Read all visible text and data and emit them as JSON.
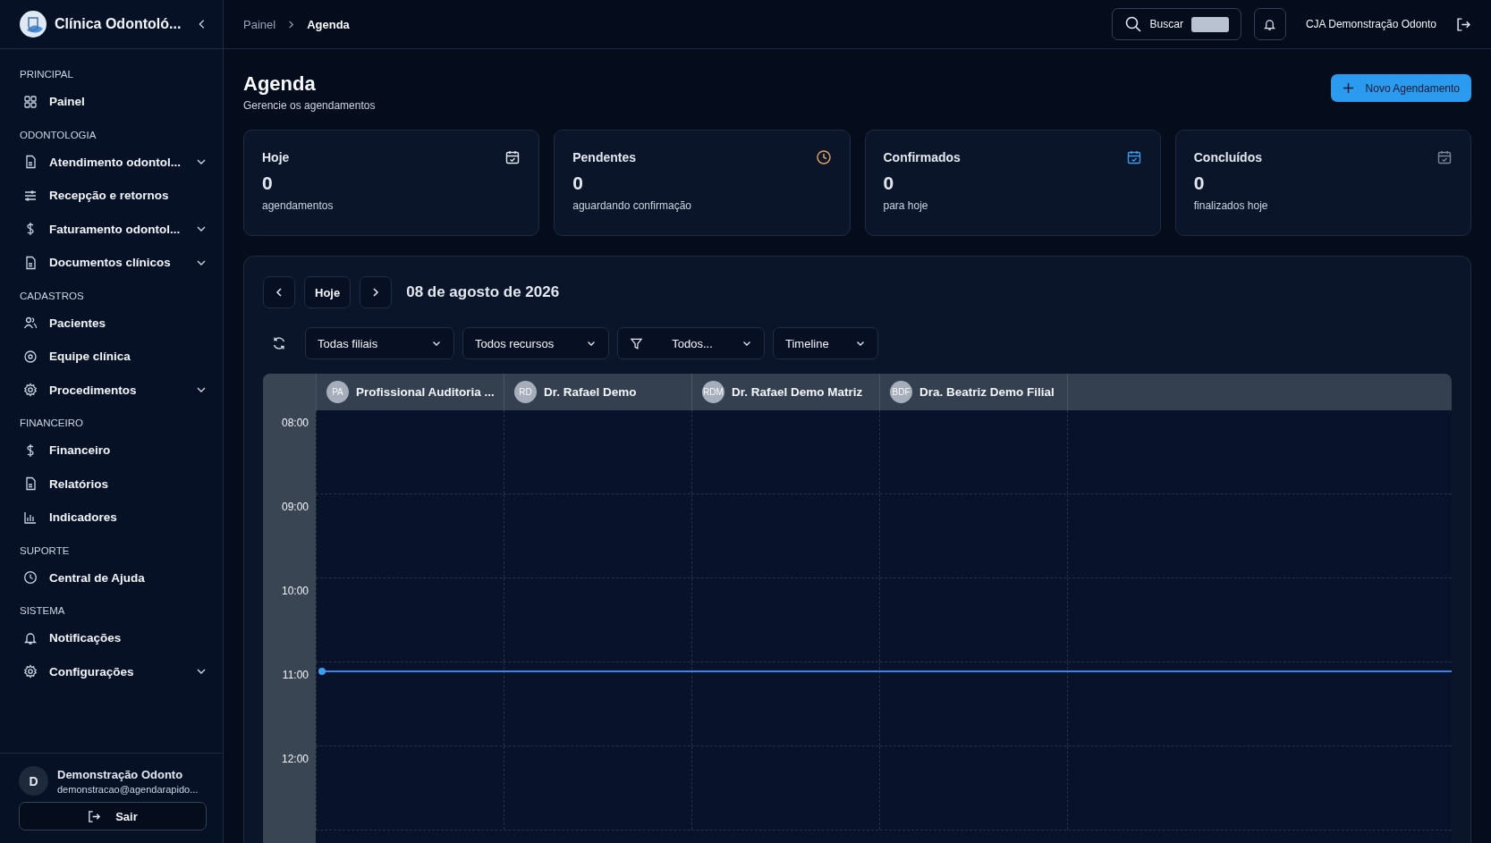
{
  "sidebar": {
    "brand": "Clínica Odontoló...",
    "sections": [
      {
        "title": "PRINCIPAL",
        "items": [
          {
            "label": "Painel",
            "expandable": false
          }
        ]
      },
      {
        "title": "ODONTOLOGIA",
        "items": [
          {
            "label": "Atendimento odontol...",
            "expandable": true
          },
          {
            "label": "Recepção e retornos",
            "expandable": false
          },
          {
            "label": "Faturamento odontol...",
            "expandable": true
          },
          {
            "label": "Documentos clínicos",
            "expandable": true
          }
        ]
      },
      {
        "title": "CADASTROS",
        "items": [
          {
            "label": "Pacientes",
            "expandable": false
          },
          {
            "label": "Equipe clínica",
            "expandable": false
          },
          {
            "label": "Procedimentos",
            "expandable": true
          }
        ]
      },
      {
        "title": "FINANCEIRO",
        "items": [
          {
            "label": "Financeiro",
            "expandable": false
          },
          {
            "label": "Relatórios",
            "expandable": false
          },
          {
            "label": "Indicadores",
            "expandable": false
          }
        ]
      },
      {
        "title": "SUPORTE",
        "items": [
          {
            "label": "Central de Ajuda",
            "expandable": false
          }
        ]
      },
      {
        "title": "SISTEMA",
        "items": [
          {
            "label": "Notificações",
            "expandable": false
          },
          {
            "label": "Configurações",
            "expandable": true
          }
        ]
      }
    ],
    "user": {
      "initial": "D",
      "name": "Demonstração Odonto",
      "email": "demonstracao@agendarapido..."
    },
    "logout": "Sair"
  },
  "breadcrumb": [
    {
      "label": "Painel",
      "current": false
    },
    {
      "label": "Agenda",
      "current": true
    }
  ],
  "topbar": {
    "search": "Buscar",
    "account": "CJA Demonstração Odonto"
  },
  "page": {
    "title": "Agenda",
    "subtitle": "Gerencie os agendamentos",
    "new_button": "Novo Agendamento"
  },
  "cards": [
    {
      "title": "Hoje",
      "value": "0",
      "caption": "agendamentos",
      "color": "#e2e8f0"
    },
    {
      "title": "Pendentes",
      "value": "0",
      "caption": "aguardando confirmação",
      "color": "#e0a060"
    },
    {
      "title": "Confirmados",
      "value": "0",
      "caption": "para hoje",
      "color": "#3b9cf0"
    },
    {
      "title": "Concluídos",
      "value": "0",
      "caption": "finalizados hoje",
      "color": "#7a8699"
    }
  ],
  "calendar": {
    "today": "Hoje",
    "date": "08 de agosto de 2026",
    "filters": [
      "Todas filiais",
      "Todos recursos",
      "Todos...",
      "Timeline"
    ],
    "resources": [
      {
        "initials": "PA",
        "name": "Profissional Auditoria ..."
      },
      {
        "initials": "RD",
        "name": "Dr. Rafael Demo"
      },
      {
        "initials": "RDM",
        "name": "Dr. Rafael Demo Matriz"
      },
      {
        "initials": "BDF",
        "name": "Dra. Beatriz Demo Filial"
      }
    ],
    "times": [
      "08:00",
      "09:00",
      "10:00",
      "11:00",
      "12:00"
    ]
  }
}
